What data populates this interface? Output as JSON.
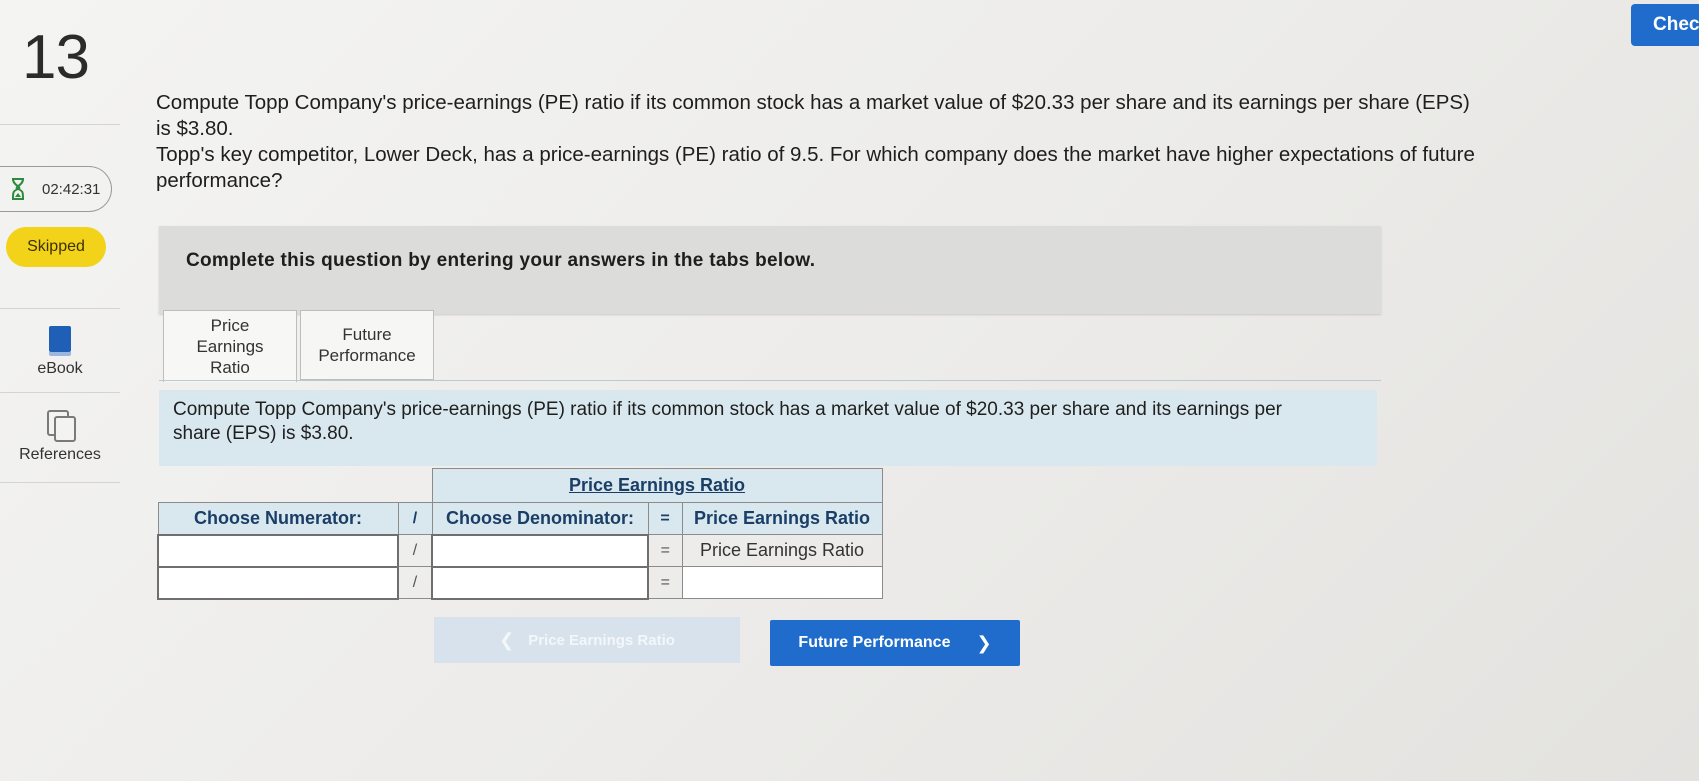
{
  "question": {
    "number": "13",
    "timer": "02:42:31",
    "status": "Skipped",
    "paragraph1": "Compute Topp Company's price-earnings (PE) ratio if its common stock has a market value of $20.33 per share and its earnings per share (EPS) is $3.80.",
    "paragraph2": "Topp's key competitor, Lower Deck, has a price-earnings (PE) ratio of 9.5. For which company does the market have higher expectations of future performance?"
  },
  "rail": {
    "ebook_label": "eBook",
    "references_label": "References"
  },
  "top": {
    "check_label": "Chec"
  },
  "banner": {
    "text": "Complete this question by entering your answers in the tabs below."
  },
  "tabs": [
    {
      "label": "Price Earnings Ratio",
      "active": true
    },
    {
      "label": "Future Performance",
      "active": false
    }
  ],
  "tab_content": {
    "prompt": "Compute Topp Company's price-earnings (PE) ratio if its common stock has a market value of $20.33 per share and its earnings per share (EPS) is $3.80."
  },
  "table": {
    "title": "Price Earnings Ratio",
    "header": {
      "numerator": "Choose Numerator:",
      "divide": "/",
      "denominator": "Choose Denominator:",
      "equals": "=",
      "result": "Price Earnings Ratio"
    },
    "rows": [
      {
        "numerator": "",
        "divide": "/",
        "denominator": "",
        "equals": "=",
        "result": "Price Earnings Ratio"
      },
      {
        "numerator": "",
        "divide": "/",
        "denominator": "",
        "equals": "=",
        "result": ""
      }
    ]
  },
  "nav": {
    "prev_label": "Price Earnings Ratio",
    "next_label": "Future Performance"
  },
  "colors": {
    "accent": "#1f6ccc",
    "skipped": "#f3d21a",
    "content_bg": "#d9e8ef",
    "banner_bg": "#dcdcda"
  }
}
